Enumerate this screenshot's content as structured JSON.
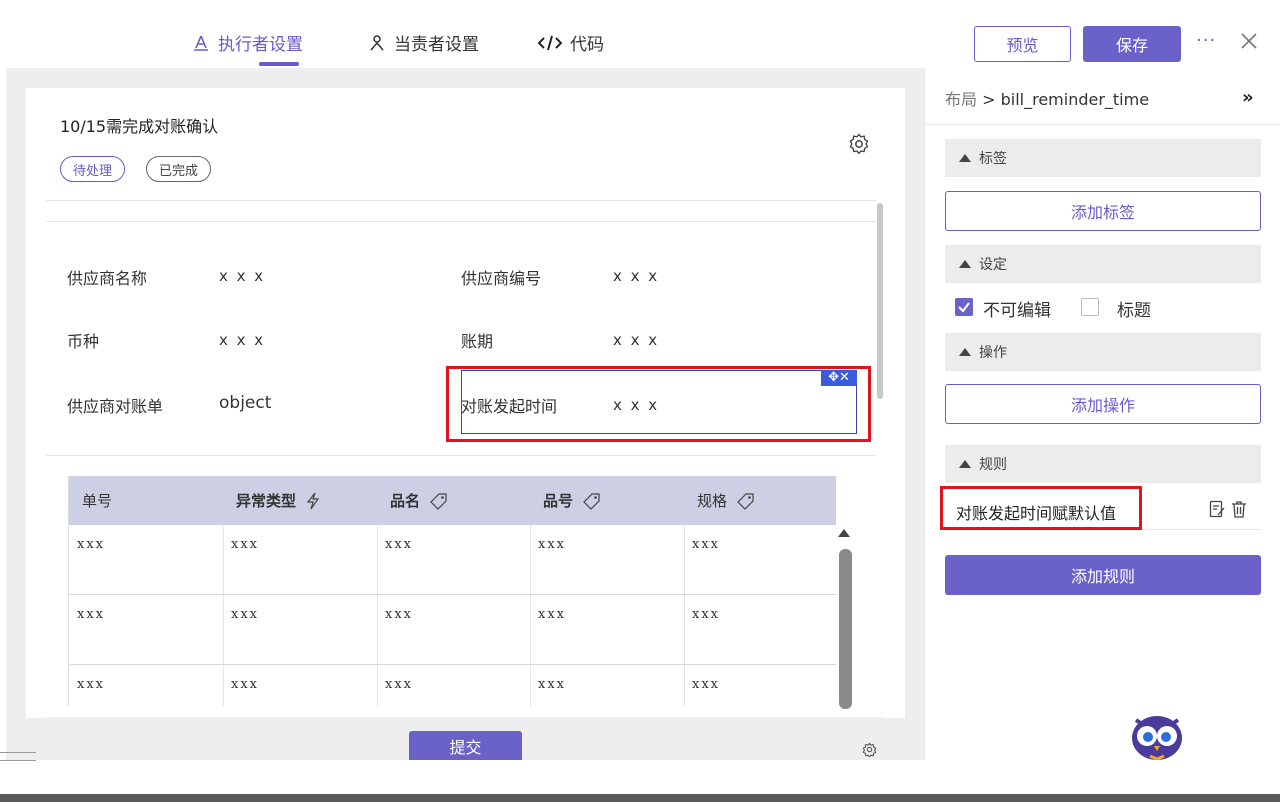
{
  "header": {
    "tabs": [
      {
        "label": "执行者设置",
        "icon": "executor-icon",
        "active": true
      },
      {
        "label": "当责者设置",
        "icon": "person-icon",
        "active": false
      },
      {
        "label": "代码",
        "icon": "code-icon",
        "active": false
      }
    ],
    "preview_label": "预览",
    "save_label": "保存",
    "more_label": "···"
  },
  "form": {
    "title": "10/15需完成对账确认",
    "tags": [
      "待处理",
      "已完成"
    ],
    "fields": [
      {
        "label": "供应商名称",
        "value": "x x x"
      },
      {
        "label": "供应商编号",
        "value": "x x x"
      },
      {
        "label": "币种",
        "value": "x x x"
      },
      {
        "label": "账期",
        "value": "x x x"
      },
      {
        "label": "供应商对账单",
        "value": "object"
      },
      {
        "label": "对账发起时间",
        "value": "x x x"
      }
    ],
    "selection_tools": "✥✕",
    "submit_label": "提交"
  },
  "table": {
    "columns": [
      {
        "label": "单号",
        "icon": ""
      },
      {
        "label": "异常类型",
        "icon": "lightning-icon"
      },
      {
        "label": "品名",
        "icon": "tag-icon"
      },
      {
        "label": "品号",
        "icon": "tag-icon"
      },
      {
        "label": "规格",
        "icon": "tag-icon"
      }
    ],
    "rows": [
      [
        "xxx",
        "xxx",
        "xxx",
        "xxx",
        "xxx"
      ],
      [
        "xxx",
        "xxx",
        "xxx",
        "xxx",
        "xxx"
      ],
      [
        "xxx",
        "xxx",
        "xxx",
        "xxx",
        "xxx"
      ]
    ]
  },
  "panel": {
    "breadcrumb_root": "布局",
    "breadcrumb_sep": " > ",
    "breadcrumb_current": "bill_reminder_time",
    "collapse_label": "»",
    "sections": {
      "tags": "标签",
      "settings": "设定",
      "actions": "操作",
      "rules": "规则"
    },
    "add_tag_label": "添加标签",
    "readonly_label": "不可编辑",
    "readonly_checked": true,
    "title_label": "标题",
    "title_checked": false,
    "add_action_label": "添加操作",
    "rule_text": "对账发起时间赋默认值",
    "add_rule_label": "添加规则"
  },
  "colors": {
    "accent": "#6a5acd",
    "primary_button": "#6a62c8",
    "highlight_red": "#e0141e",
    "table_header": "#cdd0e4"
  }
}
